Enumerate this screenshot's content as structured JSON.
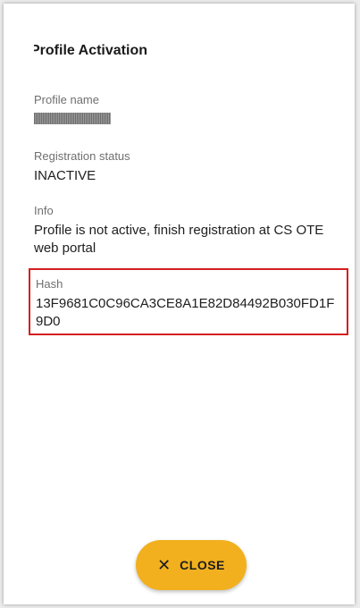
{
  "dialog": {
    "title": "Profile Activation",
    "fields": [
      {
        "label": "Profile name",
        "value": ""
      },
      {
        "label": "Registration status",
        "value": "INACTIVE"
      },
      {
        "label": "Info",
        "value": "Profile is not active, finish registration at CS OTE web portal"
      },
      {
        "label": "Hash",
        "value": "13F9681C0C96CA3CE8A1E82D84492B030FD1F9D0"
      }
    ],
    "close_button": {
      "icon": "close-icon",
      "label": "CLOSE"
    }
  },
  "colors": {
    "accent": "#f2b01e",
    "highlight": "#d41f1f"
  }
}
